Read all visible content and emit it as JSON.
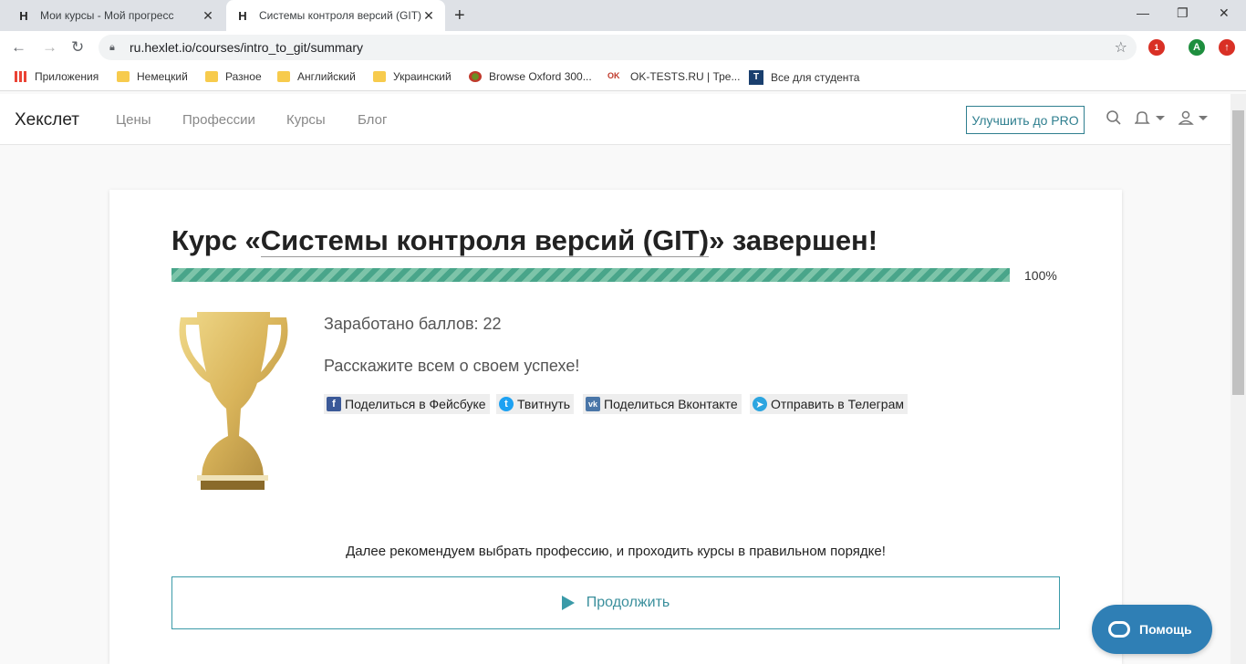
{
  "browser": {
    "tabs": [
      {
        "title": "Мои курсы - Мой прогресс",
        "favicon": "H"
      },
      {
        "title": "Системы контроля версий (GIT)",
        "favicon": "H"
      }
    ],
    "new_tab": "+",
    "window_controls": {
      "minimize": "—",
      "restore": "❐",
      "close": "✕"
    },
    "url": "ru.hexlet.io/courses/intro_to_git/summary",
    "extensions": {
      "badge_count": "1",
      "avatar_letter": "A"
    },
    "bookmarks": [
      {
        "label": "Приложения",
        "icon": "apps-grid-icon"
      },
      {
        "label": "Немецкий",
        "icon": "folder-icon"
      },
      {
        "label": "Разное",
        "icon": "folder-icon"
      },
      {
        "label": "Английский",
        "icon": "folder-icon"
      },
      {
        "label": "Украинский",
        "icon": "folder-icon"
      },
      {
        "label": "Browse Oxford 300...",
        "icon": "oxford-icon"
      },
      {
        "label": "OK-TESTS.RU | Тре...",
        "icon": "ok-tests-icon"
      },
      {
        "label": "Все для студента",
        "icon": "t-icon"
      }
    ]
  },
  "site": {
    "logo": "Хекслет",
    "nav": [
      "Цены",
      "Профессии",
      "Курсы",
      "Блог"
    ],
    "pro_button": "Улучшить до PRO"
  },
  "summary": {
    "headline_prefix": "Курс «",
    "course_name": "Системы контроля версий (GIT)",
    "headline_suffix": "» завершен!",
    "progress_percent": 100,
    "progress_label": "100%",
    "points": "Заработано баллов: 22",
    "share_prompt": "Расскажите всем о своем успехе!",
    "share_buttons": [
      {
        "label": "Поделиться в Фейсбуке",
        "icon": "facebook-icon",
        "color": "#3b5998"
      },
      {
        "label": "Твитнуть",
        "icon": "twitter-icon",
        "color": "#1da1f2"
      },
      {
        "label": "Поделиться Вконтакте",
        "icon": "vk-icon",
        "color": "#4a76a8"
      },
      {
        "label": "Отправить в Телеграм",
        "icon": "telegram-icon",
        "color": "#2ca5e0"
      }
    ],
    "recommendation": "Далее рекомендуем выбрать профессию, и проходить курсы в правильном порядке!",
    "continue_button": "Продолжить"
  },
  "help_widget": {
    "label": "Помощь"
  },
  "colors": {
    "accent": "#2f7f8f",
    "progress": "#49a58a",
    "help": "#2f7fb5"
  }
}
